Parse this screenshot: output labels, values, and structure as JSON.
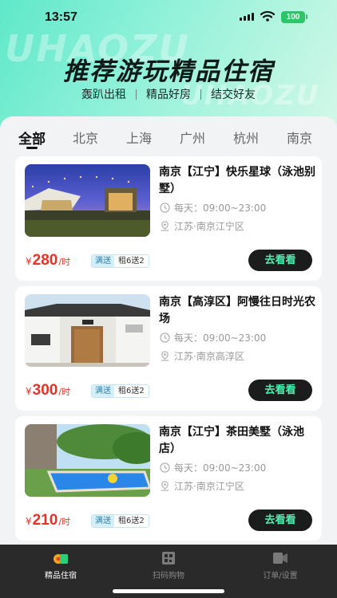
{
  "status": {
    "time": "13:57",
    "battery": "100"
  },
  "hero": {
    "watermark1": "UHAOZU",
    "watermark2": "UHAOZU",
    "title": "推荐游玩精品住宿",
    "slogans": [
      "轰趴出租",
      "精品好房",
      "结交好友"
    ]
  },
  "tabs": [
    "全部",
    "北京",
    "上海",
    "广州",
    "杭州",
    "南京"
  ],
  "cards": [
    {
      "title": "南京【江宁】快乐星球（泳池别墅）",
      "hours": "每天：09:00~23:00",
      "location": "江苏·南京江宁区",
      "currency": "¥",
      "price": "280",
      "unit": "/时",
      "tag1": "满送",
      "tag2": "租6送2",
      "button": "去看看"
    },
    {
      "title": "南京【高淳区】阿慢往日时光农场",
      "hours": "每天：09:00~23:00",
      "location": "江苏·南京高淳区",
      "currency": "¥",
      "price": "300",
      "unit": "/时",
      "tag1": "满送",
      "tag2": "租6送2",
      "button": "去看看"
    },
    {
      "title": "南京【江宁】茶田美墅（泳池店）",
      "hours": "每天：09:00~23:00",
      "location": "江苏·南京江宁区",
      "currency": "¥",
      "price": "210",
      "unit": "/时",
      "tag1": "满送",
      "tag2": "租6送2",
      "button": "去看看"
    }
  ],
  "tabbar": {
    "items": [
      "精品住宿",
      "扫码购物",
      "订单/设置"
    ]
  },
  "colors": {
    "accent": "#4ef0b0",
    "price": "#e1342b",
    "hero": "#5fe8c9"
  }
}
